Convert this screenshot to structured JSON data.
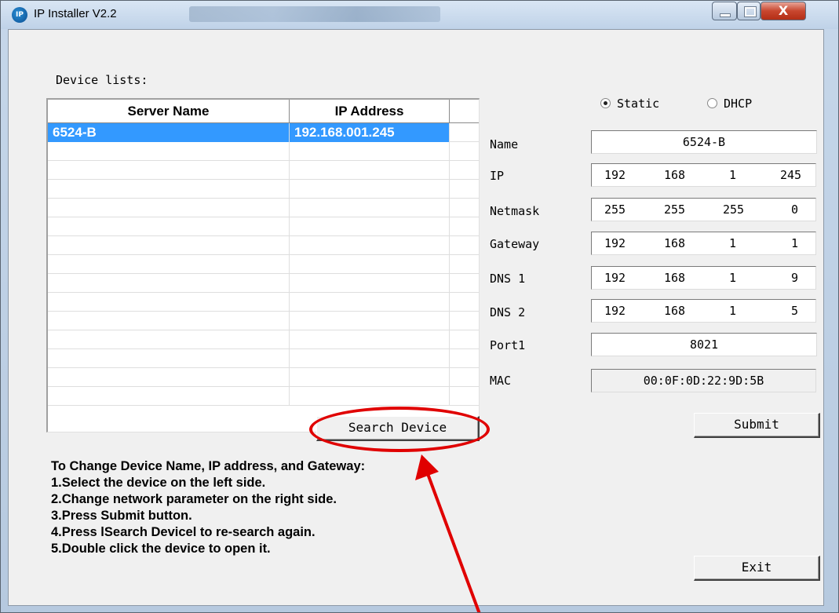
{
  "window": {
    "title": "IP Installer V2.2",
    "icon": "ip-app-icon",
    "controls": {
      "minimize": "minimize-icon",
      "maximize": "maximize-icon",
      "close": "X"
    }
  },
  "device_list": {
    "label": "Device lists:",
    "columns": [
      "Server Name",
      "IP Address"
    ],
    "rows": [
      {
        "server_name": "6524-B",
        "ip_address": "192.168.001.245",
        "selected": true
      }
    ]
  },
  "mode": {
    "static_label": "Static",
    "dhcp_label": "DHCP",
    "selected": "Static"
  },
  "fields": {
    "name": {
      "label": "Name",
      "value": "6524-B"
    },
    "ip": {
      "label": "IP",
      "octets": [
        "192",
        "168",
        "1",
        "245"
      ]
    },
    "netmask": {
      "label": "Netmask",
      "octets": [
        "255",
        "255",
        "255",
        "0"
      ]
    },
    "gateway": {
      "label": "Gateway",
      "octets": [
        "192",
        "168",
        "1",
        "1"
      ]
    },
    "dns1": {
      "label": "DNS 1",
      "octets": [
        "192",
        "168",
        "1",
        "9"
      ]
    },
    "dns2": {
      "label": "DNS 2",
      "octets": [
        "192",
        "168",
        "1",
        "5"
      ]
    },
    "port1": {
      "label": "Port1",
      "value": "8021"
    },
    "mac": {
      "label": "MAC",
      "value": "00:0F:0D:22:9D:5B"
    }
  },
  "buttons": {
    "search_device": "Search Device",
    "submit": "Submit",
    "exit": "Exit"
  },
  "instructions": [
    "To Change Device Name, IP address, and Gateway:",
    "1.Select the device on the left side.",
    "2.Change network parameter on the right side.",
    "3.Press Submit button.",
    "4.Press lSearch Devicel to re-search again.",
    "5.Double click the device to open it."
  ],
  "annotation": {
    "color": "#e00000",
    "target": "Search Device"
  },
  "colors": {
    "selection": "#3399ff",
    "dialog_bg": "#f0f0f0"
  }
}
